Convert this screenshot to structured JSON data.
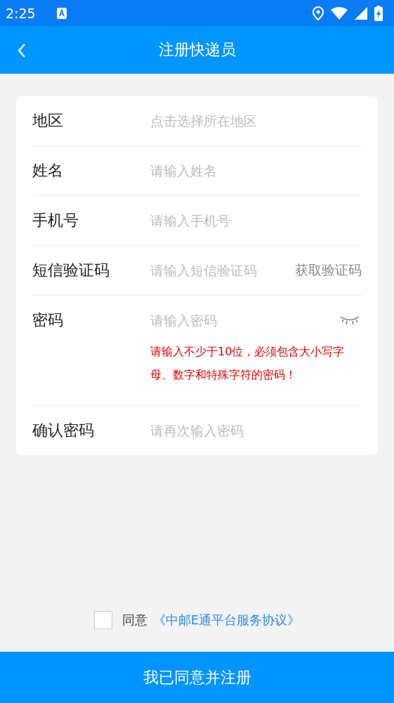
{
  "status_bar": {
    "time": "2:25"
  },
  "header": {
    "title": "注册快递员"
  },
  "fields": [
    {
      "kind": "plain",
      "label": "地区",
      "placeholder": "点击选择所在地区"
    },
    {
      "kind": "plain",
      "label": "姓名",
      "placeholder": "请输入姓名"
    },
    {
      "kind": "plain",
      "label": "手机号",
      "placeholder": "请输入手机号"
    },
    {
      "kind": "code",
      "label": "短信验证码",
      "placeholder": "请输入短信验证码",
      "action": "获取验证码"
    },
    {
      "kind": "password",
      "label": "密码",
      "placeholder": "请输入密码",
      "visible": false,
      "hint": "请输入不少于10位，必须包含大小写字母、数字和特殊字符的密码！"
    },
    {
      "kind": "plain",
      "label": "确认密码",
      "placeholder": "请再次输入密码"
    }
  ],
  "agreement": {
    "checked": false,
    "text": "同意",
    "link": "《中邮E通平台服务协议》"
  },
  "submit_button": "我已同意并注册"
}
